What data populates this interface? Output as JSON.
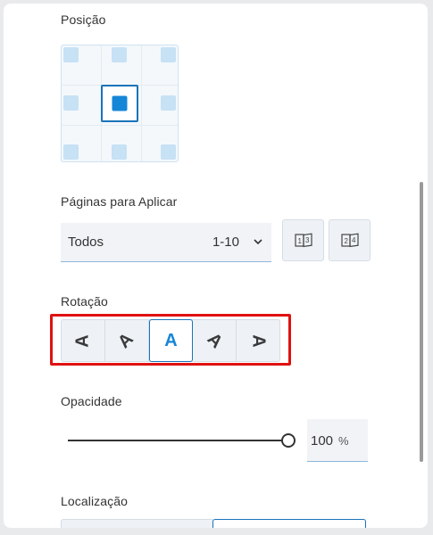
{
  "sections": {
    "position": "Posição",
    "pages": "Páginas para Aplicar",
    "rotation": "Rotação",
    "opacity": "Opacidade",
    "location": "Localização"
  },
  "position_grid": {
    "cells": [
      "top-left",
      "top-center",
      "top-right",
      "middle-left",
      "center",
      "middle-right",
      "bottom-left",
      "bottom-center",
      "bottom-right"
    ],
    "selected": "center"
  },
  "pages_select": {
    "value": "Todos",
    "range": "1-10",
    "icon": "chevron-down-icon"
  },
  "page_buttons": [
    {
      "icon": "odd-pages-icon"
    },
    {
      "icon": "even-pages-icon"
    }
  ],
  "rotation": {
    "glyph": "A",
    "options": [
      "-90",
      "-45",
      "0",
      "45",
      "90"
    ],
    "selected": "0"
  },
  "opacity": {
    "value": "100",
    "unit": "%",
    "level": 1.0
  },
  "colors": {
    "accent": "#1585d8",
    "selection_border": "#1a73b8",
    "highlight": "#e01111"
  }
}
